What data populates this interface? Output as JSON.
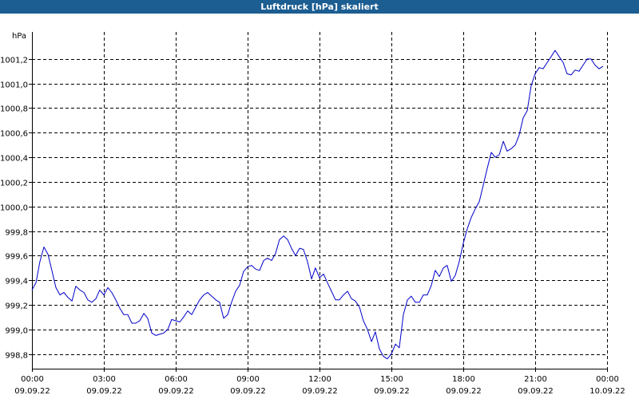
{
  "window": {
    "title": "Luftdruck [hPa] skaliert"
  },
  "chart_data": {
    "type": "line",
    "title": "Luftdruck [hPa] skaliert",
    "ylabel": "hPa",
    "xlabel": "",
    "ylim": [
      998.68,
      1001.42
    ],
    "xlim": [
      0,
      24
    ],
    "grid": true,
    "y_ticks": [
      998.8,
      999.0,
      999.2,
      999.4,
      999.6,
      999.8,
      1000.0,
      1000.2,
      1000.4,
      1000.6,
      1000.8,
      1001.0,
      1001.2
    ],
    "y_tick_labels": [
      "998,8",
      "999,0",
      "999,2",
      "999,4",
      "999,6",
      "999,8",
      "1000,0",
      "1000,2",
      "1000,4",
      "1000,6",
      "1000,8",
      "1001,0",
      "1001,2"
    ],
    "x_ticks": [
      0,
      3,
      6,
      9,
      12,
      15,
      18,
      21,
      24
    ],
    "x_tick_labels": [
      [
        "00:00",
        "09.09.22"
      ],
      [
        "03:00",
        "09.09.22"
      ],
      [
        "06:00",
        "09.09.22"
      ],
      [
        "09:00",
        "09.09.22"
      ],
      [
        "12:00",
        "09.09.22"
      ],
      [
        "15:00",
        "09.09.22"
      ],
      [
        "18:00",
        "09.09.22"
      ],
      [
        "21:00",
        "09.09.22"
      ],
      [
        "00:00",
        "10.09.22"
      ]
    ],
    "series": [
      {
        "color": "#0000c8",
        "x": [
          0.0,
          0.17,
          0.33,
          0.5,
          0.67,
          0.83,
          1.0,
          1.17,
          1.33,
          1.5,
          1.67,
          1.83,
          2.0,
          2.17,
          2.33,
          2.5,
          2.67,
          2.83,
          3.0,
          3.17,
          3.33,
          3.5,
          3.67,
          3.83,
          4.0,
          4.17,
          4.33,
          4.5,
          4.67,
          4.83,
          5.0,
          5.17,
          5.33,
          5.5,
          5.67,
          5.83,
          6.0,
          6.17,
          6.33,
          6.5,
          6.67,
          6.83,
          7.0,
          7.17,
          7.33,
          7.5,
          7.67,
          7.83,
          8.0,
          8.17,
          8.33,
          8.5,
          8.67,
          8.83,
          9.0,
          9.17,
          9.33,
          9.5,
          9.67,
          9.83,
          10.0,
          10.17,
          10.33,
          10.5,
          10.67,
          10.83,
          11.0,
          11.17,
          11.33,
          11.5,
          11.67,
          11.83,
          12.0,
          12.17,
          12.33,
          12.5,
          12.67,
          12.83,
          13.0,
          13.17,
          13.33,
          13.5,
          13.67,
          13.83,
          14.0,
          14.17,
          14.33,
          14.5,
          14.67,
          14.83,
          15.0,
          15.17,
          15.33,
          15.5,
          15.67,
          15.83,
          16.0,
          16.17,
          16.33,
          16.5,
          16.67,
          16.83,
          17.0,
          17.17,
          17.33,
          17.5,
          17.67,
          17.83,
          18.0,
          18.17,
          18.33,
          18.5,
          18.67,
          18.83,
          19.0,
          19.17,
          19.33,
          19.5,
          19.67,
          19.83,
          20.0,
          20.17,
          20.33,
          20.5,
          20.67,
          20.83,
          21.0,
          21.17,
          21.33,
          21.5,
          21.67,
          21.83,
          22.0,
          22.17,
          22.33,
          22.5,
          22.67,
          22.83,
          23.0,
          23.17,
          23.33,
          23.5,
          23.67,
          23.83
        ],
        "y": [
          999.32,
          999.38,
          999.55,
          999.67,
          999.61,
          999.48,
          999.34,
          999.28,
          999.3,
          999.26,
          999.23,
          999.35,
          999.32,
          999.3,
          999.24,
          999.22,
          999.25,
          999.32,
          999.28,
          999.34,
          999.3,
          999.24,
          999.17,
          999.12,
          999.12,
          999.05,
          999.05,
          999.07,
          999.13,
          999.09,
          998.97,
          998.95,
          998.96,
          998.97,
          999.0,
          999.08,
          999.07,
          999.06,
          999.1,
          999.15,
          999.12,
          999.18,
          999.24,
          999.28,
          999.3,
          999.27,
          999.24,
          999.22,
          999.09,
          999.12,
          999.22,
          999.31,
          999.36,
          999.47,
          999.51,
          999.52,
          999.49,
          999.48,
          999.56,
          999.58,
          999.56,
          999.62,
          999.73,
          999.76,
          999.73,
          999.66,
          999.6,
          999.66,
          999.65,
          999.55,
          999.41,
          999.5,
          999.42,
          999.45,
          999.38,
          999.31,
          999.24,
          999.24,
          999.28,
          999.31,
          999.25,
          999.23,
          999.18,
          999.07,
          999.0,
          998.9,
          998.98,
          998.84,
          998.78,
          998.76,
          998.8,
          998.88,
          998.85,
          999.12,
          999.24,
          999.27,
          999.22,
          999.22,
          999.28,
          999.28,
          999.36,
          999.48,
          999.43,
          999.5,
          999.52,
          999.39,
          999.44,
          999.55,
          999.7,
          999.82,
          999.91,
          999.98,
          1000.04,
          1000.17,
          1000.31,
          1000.44,
          1000.4,
          1000.42,
          1000.53,
          1000.45,
          1000.47,
          1000.5,
          1000.58,
          1000.72,
          1000.78,
          1000.98,
          1001.08,
          1001.13,
          1001.12,
          1001.17,
          1001.22,
          1001.27,
          1001.22,
          1001.17,
          1001.08,
          1001.07,
          1001.11,
          1001.1,
          1001.15,
          1001.2,
          1001.2,
          1001.15,
          1001.12,
          1001.14
        ]
      }
    ]
  }
}
